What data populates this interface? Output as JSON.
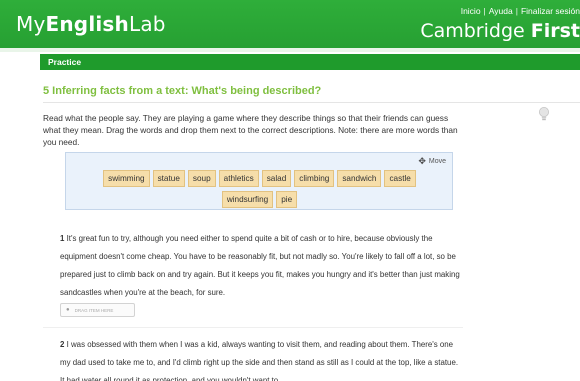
{
  "header": {
    "logo_prefix": "My",
    "logo_bold": "English",
    "logo_suffix": "Lab",
    "links": [
      "Inicio",
      "Ayuda",
      "Finalizar sesión"
    ],
    "brand_prefix": "Cambridge ",
    "brand_bold": "First"
  },
  "practice": {
    "label": "Practice"
  },
  "exercise": {
    "title": "5 Inferring facts from a text: What's being described?",
    "instructions": "Read what the people say. They are playing a game where they describe things so that their friends can guess what they mean. Drag the words and drop them next to the correct descriptions. Note: there are more words than you need."
  },
  "word_bank": {
    "move_label": "Move",
    "words": [
      "swimming",
      "statue",
      "soup",
      "athletics",
      "salad",
      "climbing",
      "sandwich",
      "castle",
      "windsurfing",
      "pie"
    ]
  },
  "items": [
    {
      "number": "1",
      "text": "It's great fun to try, although you need either to spend quite a bit of cash or to hire, because obviously the equipment doesn't come cheap. You have to be reasonably fit, but not madly so. You're likely to fall off a lot, so be prepared just to climb back on and try again. But it keeps you fit, makes you hungry and it's better than just making sandcastles when you're at the beach, for sure.",
      "drop_label": "DRAG ITEM HERE"
    },
    {
      "number": "2",
      "text": "I was obsessed with them when I was a kid, always wanting to visit them, and reading about them. There's one my dad used to take me to, and I'd climb right up the side and then stand as still as I could at the top, like a statue. It had water all round it as protection, and you wouldn't want to"
    }
  ],
  "colors": {
    "header_green": "#2fae3a",
    "practice_green": "#1f9b2c",
    "title_green": "#7fbf3f",
    "chip_fill": "#f6deaa",
    "bank_fill": "#eaf2fb"
  },
  "icons": [
    "lightbulb-icon",
    "move-icon"
  ]
}
